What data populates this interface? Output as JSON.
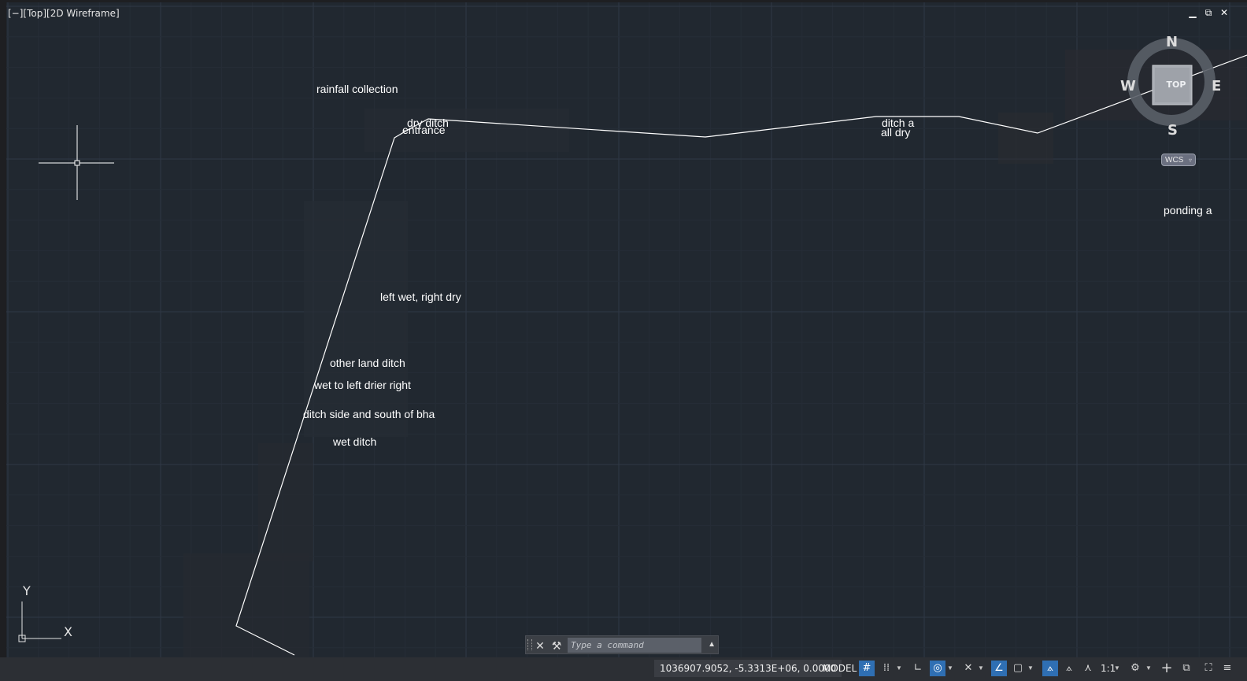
{
  "viewport": {
    "label": "[−][Top][2D Wireframe]",
    "window_controls": {
      "minimize": "▁",
      "restore": "⧉",
      "close": "✕"
    }
  },
  "annotations": {
    "rainfall_collection": "rainfall collection",
    "dry_ditch": "dry ditch",
    "entrance": "entrance",
    "ditch_a": "ditch a",
    "all_dry": "all dry",
    "ponding_a": "ponding a",
    "left_wet_right_dry": "left wet, right dry",
    "other_land_ditch": "other land ditch",
    "wet_to_left": "wet to left drier right",
    "ditch_side": "ditch side and south of bha",
    "wet_ditch": "wet ditch"
  },
  "viewcube": {
    "n": "N",
    "s": "S",
    "e": "E",
    "w": "W",
    "top": "TOP",
    "wcs": "WCS",
    "wcs_arrow": "▿"
  },
  "ucs_icon": {
    "y": "Y",
    "x": "X"
  },
  "command_line": {
    "placeholder": "Type a command",
    "close_icon": "✕",
    "customize_icon": "⚒",
    "history_icon": "▲"
  },
  "status_bar": {
    "coordinates": "1036907.9052, -5.3313E+06, 0.0000",
    "model": "MODEL",
    "scale": "1:1",
    "toggles": {
      "grid": true,
      "snap": false,
      "ortho": false,
      "polar": true,
      "isodraft": false,
      "osnap_tracking": true,
      "osnap_2d": false,
      "annotation_visibility": true
    }
  },
  "colors": {
    "viewport_bg": "#212830",
    "grid_minor": "#262d37",
    "grid_major": "#303846",
    "drawing_line": "#ffffff",
    "statusbar_bg": "#2c2f34",
    "toggle_on": "#2f6fb3"
  }
}
